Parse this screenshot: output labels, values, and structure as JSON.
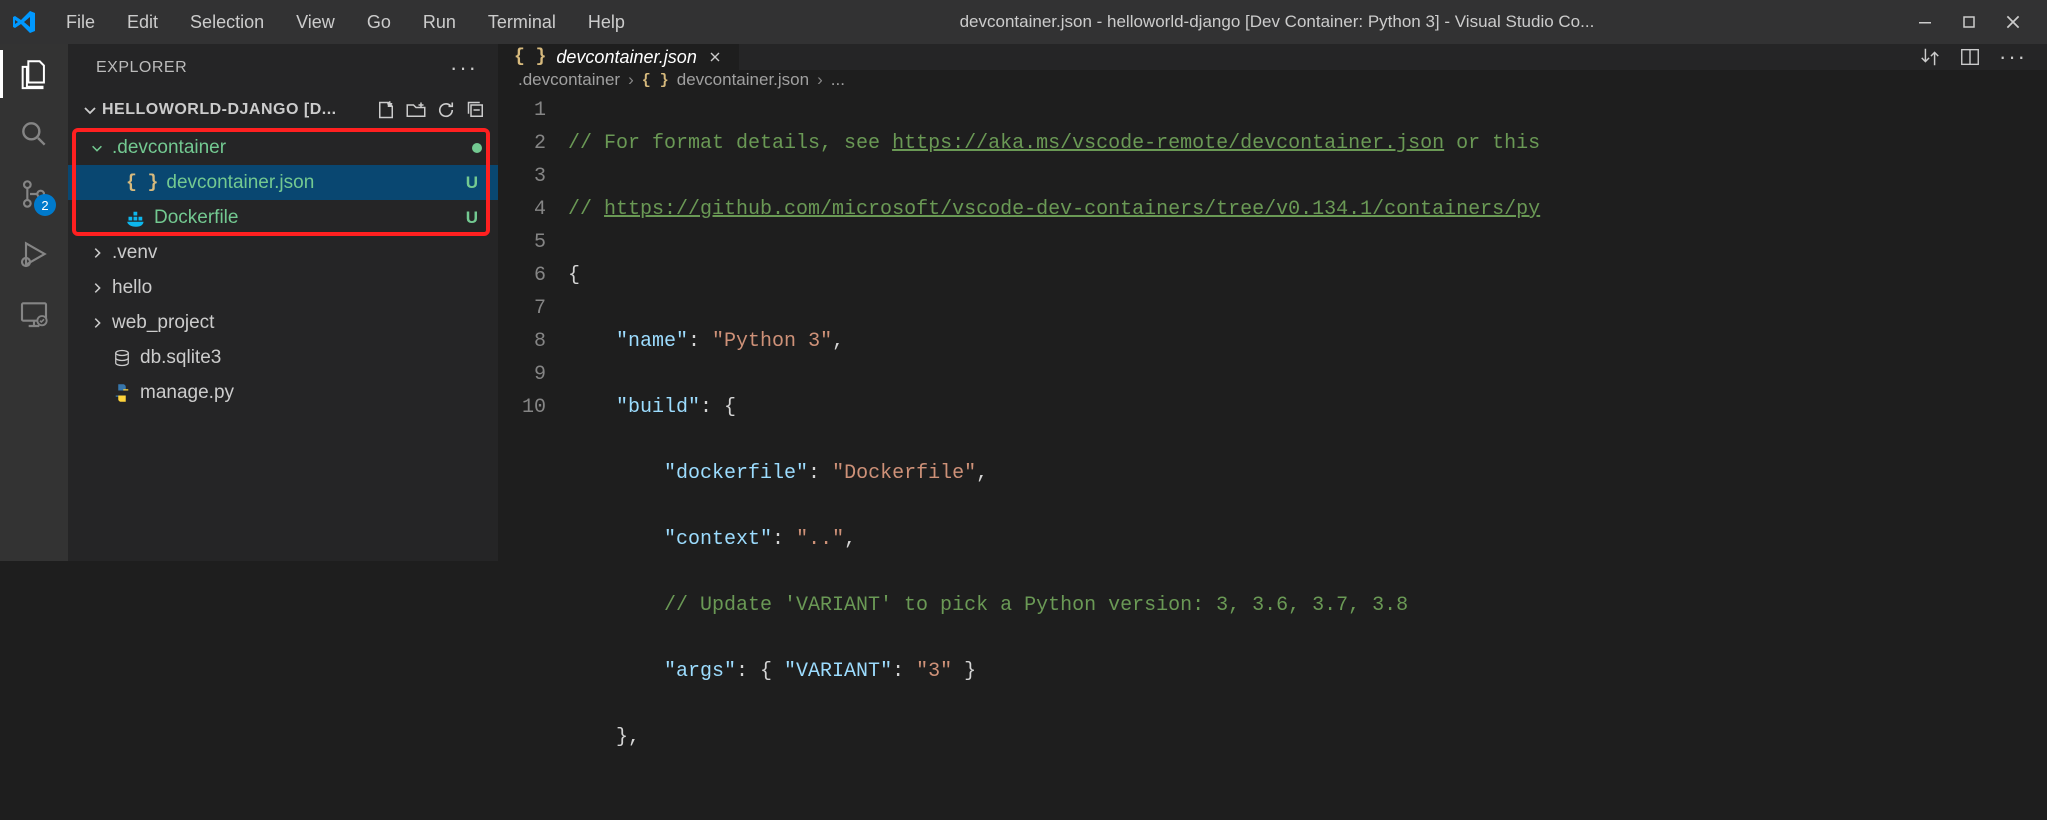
{
  "window": {
    "title": "devcontainer.json - helloworld-django [Dev Container: Python 3] - Visual Studio Co..."
  },
  "menu": {
    "file": "File",
    "edit": "Edit",
    "selection": "Selection",
    "view": "View",
    "go": "Go",
    "run": "Run",
    "terminal": "Terminal",
    "help": "Help"
  },
  "activitybar": {
    "scm_badge": "2"
  },
  "sidebar": {
    "title": "EXPLORER",
    "project_title": "HELLOWORLD-DJANGO [D...",
    "tree": {
      "devcontainer_folder": ".devcontainer",
      "devcontainer_json": "devcontainer.json",
      "devcontainer_json_status": "U",
      "dockerfile": "Dockerfile",
      "dockerfile_status": "U",
      "venv": ".venv",
      "hello": "hello",
      "web_project": "web_project",
      "db_sqlite3": "db.sqlite3",
      "manage_py": "manage.py"
    }
  },
  "tabs": {
    "active": "devcontainer.json"
  },
  "breadcrumb": {
    "seg1": ".devcontainer",
    "seg2": "devcontainer.json",
    "seg3": "..."
  },
  "code": {
    "line_numbers": [
      "1",
      "2",
      "3",
      "4",
      "5",
      "6",
      "7",
      "8",
      "9",
      "10"
    ],
    "l1_pre": "// For format details, see ",
    "l1_link": "https://aka.ms/vscode-remote/devcontainer.json",
    "l1_post": " or this",
    "l2_pre": "// ",
    "l2_link": "https://github.com/microsoft/vscode-dev-containers/tree/v0.134.1/containers/py",
    "l3": "{",
    "l4_key": "\"name\"",
    "l4_val": "\"Python 3\"",
    "l5_key": "\"build\"",
    "l6_key": "\"dockerfile\"",
    "l6_val": "\"Dockerfile\"",
    "l7_key": "\"context\"",
    "l7_val": "\"..\"",
    "l8_comment": "// Update 'VARIANT' to pick a Python version: 3, 3.6, 3.7, 3.8",
    "l9_key": "\"args\"",
    "l9_ikey": "\"VARIANT\"",
    "l9_ival": "\"3\"",
    "l10": "},"
  }
}
